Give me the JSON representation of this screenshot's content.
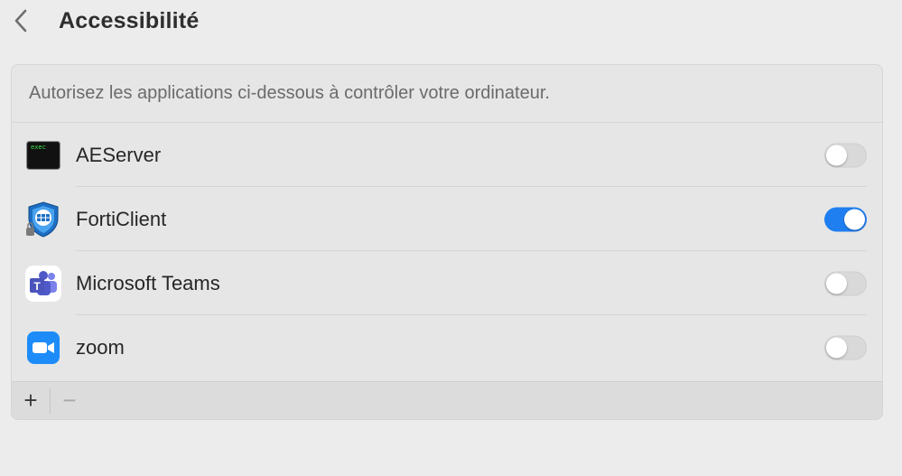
{
  "header": {
    "title": "Accessibilité",
    "back_icon": "chevron-left-icon"
  },
  "panel": {
    "description": "Autorisez les applications ci-dessous à contrôler votre ordinateur.",
    "apps": [
      {
        "name": "AEServer",
        "icon": "terminal-exec-icon",
        "icon_text": "exec",
        "enabled": false
      },
      {
        "name": "FortiClient",
        "icon": "forticlient-shield-icon",
        "enabled": true
      },
      {
        "name": "Microsoft Teams",
        "icon": "teams-icon",
        "enabled": false
      },
      {
        "name": "zoom",
        "icon": "zoom-camera-icon",
        "enabled": false
      }
    ],
    "add_label": "+",
    "remove_label": "−"
  },
  "colors": {
    "toggle_on": "#1f7ef0",
    "toggle_off": "#d9d9d9",
    "background": "#ececec"
  }
}
